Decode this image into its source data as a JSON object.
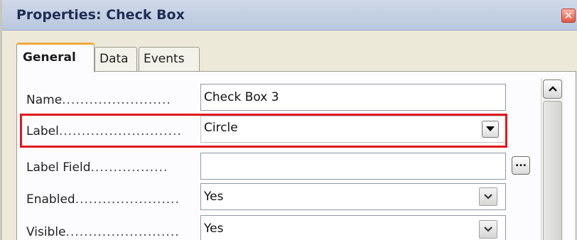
{
  "window": {
    "title": "Properties: Check Box",
    "close_glyph": "✕"
  },
  "tabs": [
    {
      "label": "General",
      "active": true
    },
    {
      "label": "Data",
      "active": false
    },
    {
      "label": "Events",
      "active": false
    }
  ],
  "properties": [
    {
      "label": "Name",
      "dots": "........................",
      "value": "Check Box 3",
      "control": "text"
    },
    {
      "label": "Label",
      "dots": "...........................",
      "value": "Circle",
      "control": "combo",
      "highlighted": true
    },
    {
      "label": "Label Field",
      "dots": ".................",
      "value": "",
      "control": "text-with-ellipsis"
    },
    {
      "label": "Enabled",
      "dots": ".......................",
      "value": "Yes",
      "control": "select"
    },
    {
      "label": "Visible",
      "dots": ".........................",
      "value": "Yes",
      "control": "select"
    }
  ],
  "buttons": {
    "ellipsis_label": "..."
  },
  "colors": {
    "highlight": "#e0181e",
    "active_tab_accent": "#f0a83a",
    "title_text": "#1f2d55"
  },
  "icons": {
    "close": "close-icon",
    "dropdown": "chevron-down-icon",
    "scroll_up": "chevron-up-icon"
  }
}
